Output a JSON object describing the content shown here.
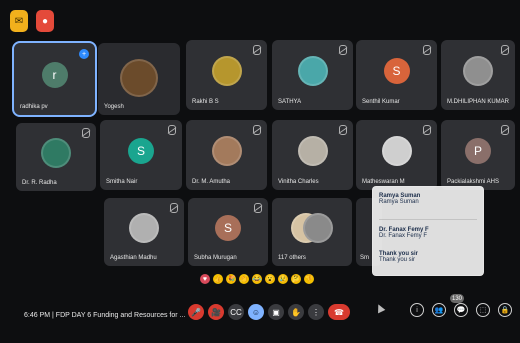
{
  "top": {
    "left_icon": "mail-icon",
    "right_icon": "record-icon"
  },
  "tiles": [
    {
      "name": "radhika pv",
      "avatar_letter": "r",
      "avatar_color": "#4e7c6a",
      "active": true,
      "pinned": true,
      "pin_label": "+"
    },
    {
      "name": "Yogesh",
      "avatar_letter": "",
      "avatar_color": "#6b4b2b"
    },
    {
      "name": "Rakhi B S",
      "avatar_letter": "",
      "avatar_color": "#b6962d"
    },
    {
      "name": "SATHYA",
      "avatar_letter": "",
      "avatar_color": "#4aa7a9"
    },
    {
      "name": "Senthil Kumar",
      "avatar_letter": "S",
      "avatar_color": "#d8643b"
    },
    {
      "name": "M.DHILIPHAN KUMAR",
      "avatar_letter": "",
      "avatar_color": "#8f8f8f"
    },
    {
      "name": "Dr. R. Radha",
      "avatar_letter": "",
      "avatar_color": "#2f7a63"
    },
    {
      "name": "Smitha Nair",
      "avatar_letter": "S",
      "avatar_color": "#1aa58f"
    },
    {
      "name": "Dr. M. Amutha",
      "avatar_letter": "",
      "avatar_color": "#a37a5c"
    },
    {
      "name": "Vinitha Charles",
      "avatar_letter": "",
      "avatar_color": "#b6b0a5"
    },
    {
      "name": "Matheswaran M",
      "avatar_letter": "",
      "avatar_color": "#cfcfcf"
    },
    {
      "name": "Packialakshmi AHS",
      "avatar_letter": "P",
      "avatar_color": "#8a6f6a"
    },
    {
      "name": "Agasthian Madhu",
      "avatar_letter": "",
      "avatar_color": "#b0b0b0"
    },
    {
      "name": "Subha Murugan",
      "avatar_letter": "S",
      "avatar_color": "#a86f59"
    },
    {
      "name": "117 others",
      "avatar_letter": "",
      "avatar_color": "#d6c3a3"
    },
    {
      "name": "Sm",
      "avatar_letter": "",
      "avatar_color": "#5a5a5a"
    }
  ],
  "chat": {
    "messages": [
      {
        "name": "Ramya Suman",
        "text": "Ramya Suman"
      },
      {
        "name": "Dr. Fanax Femy F",
        "text": "Dr. Fanax Femy F"
      },
      {
        "name": "Thank you sir",
        "text": "Thank you sir"
      }
    ]
  },
  "bottom": {
    "time": "6:46 PM",
    "meeting_title": "FDP DAY 6 Funding and Resources for ...",
    "participants_count": "130"
  }
}
